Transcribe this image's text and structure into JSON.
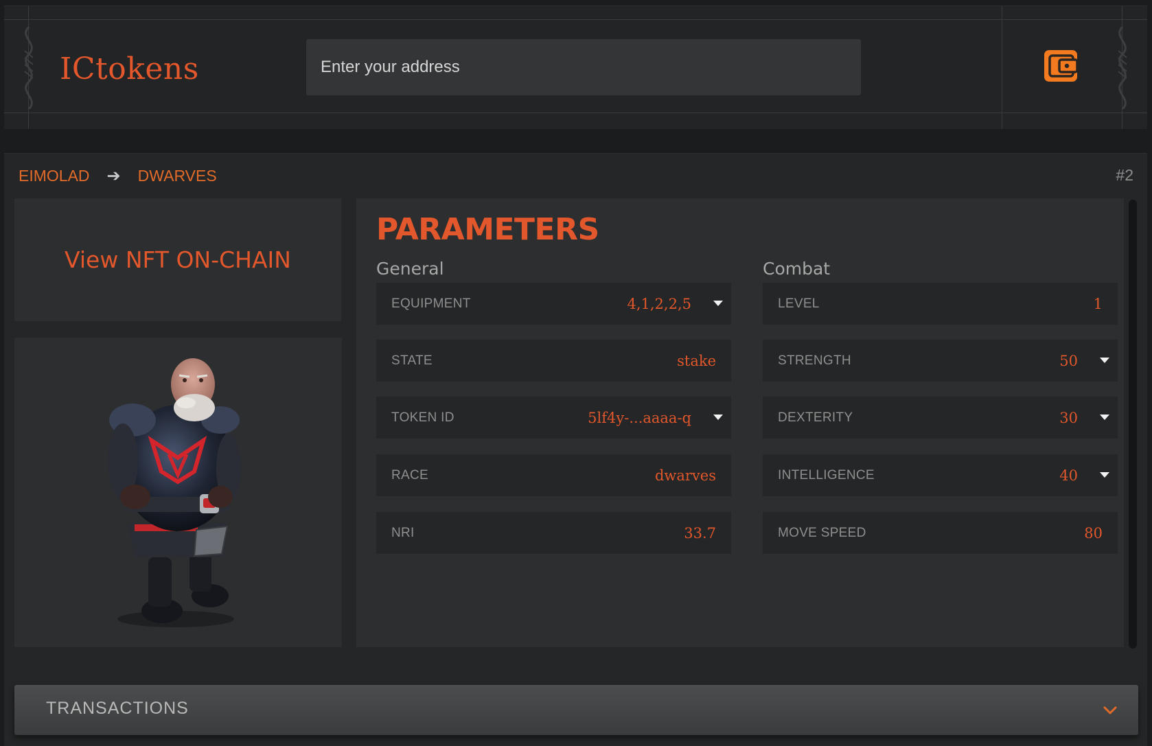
{
  "header": {
    "logo": "ICtokens",
    "search": {
      "placeholder": "Enter your address",
      "value": ""
    },
    "wallet_icon": "wallet-icon"
  },
  "breadcrumb": {
    "items": [
      "EIMOLAD",
      "DWARVES"
    ],
    "separator": "➔"
  },
  "token_number": "#2",
  "view_nft_label": "View NFT ON-CHAIN",
  "character_image": "dwarf-character",
  "parameters": {
    "title": "PARAMETERS",
    "general": {
      "title": "General",
      "rows": [
        {
          "label": "EQUIPMENT",
          "value": "4,1,2,2,5",
          "dropdown": true
        },
        {
          "label": "STATE",
          "value": "stake",
          "dropdown": false
        },
        {
          "label": "TOKEN ID",
          "value": "5lf4y-...aaaa-q",
          "dropdown": true
        },
        {
          "label": "RACE",
          "value": "dwarves",
          "dropdown": false
        },
        {
          "label": "NRI",
          "value": "33.7",
          "dropdown": false
        }
      ]
    },
    "combat": {
      "title": "Combat",
      "rows": [
        {
          "label": "LEVEL",
          "value": "1",
          "dropdown": false
        },
        {
          "label": "STRENGTH",
          "value": "50",
          "dropdown": true
        },
        {
          "label": "DEXTERITY",
          "value": "30",
          "dropdown": true
        },
        {
          "label": "INTELLIGENCE",
          "value": "40",
          "dropdown": true
        },
        {
          "label": "MOVE SPEED",
          "value": "80",
          "dropdown": false
        }
      ]
    }
  },
  "transactions": {
    "label": "TRANSACTIONS"
  },
  "colors": {
    "accent": "#e2572b",
    "background": "#1b1c1d",
    "panel": "#252627",
    "card": "#2d2e2f"
  }
}
